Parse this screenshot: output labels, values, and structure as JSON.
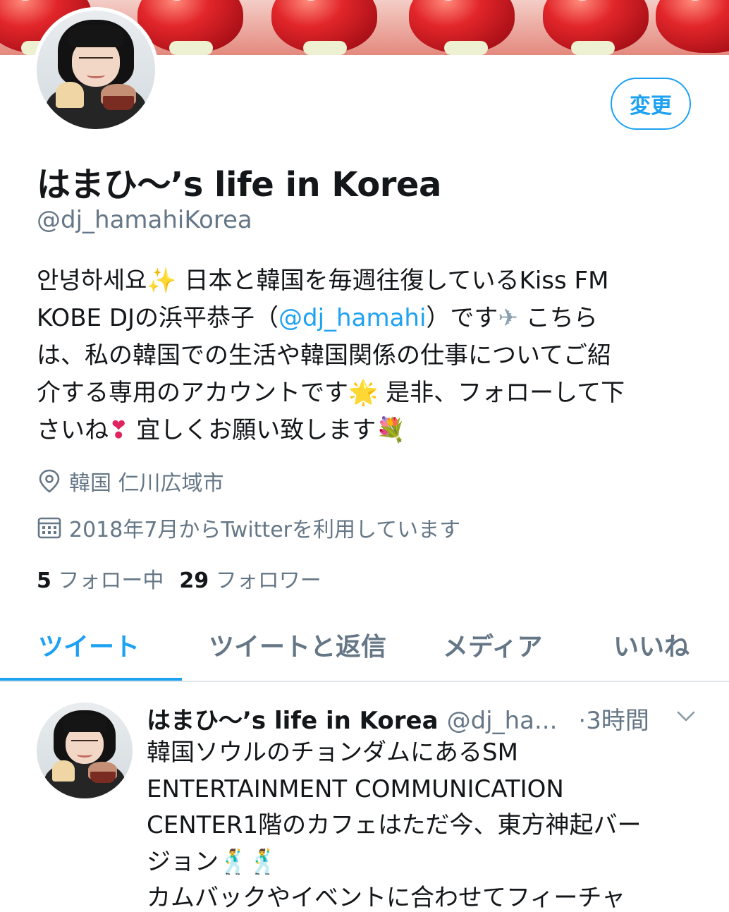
{
  "colors": {
    "accent": "#1da1f2",
    "text_primary": "#14171a",
    "text_secondary": "#657786",
    "divider": "#e1e8ed"
  },
  "header": {
    "banner_icon": "strawberry-banner-image",
    "avatar_icon": "profile-avatar-photo"
  },
  "profile": {
    "edit_button_label": "変更",
    "display_name": "はまひ〜’s life in Korea",
    "handle": "@dj_hamahiKorea",
    "bio": {
      "line1_text": "안녕하세요",
      "line1_emoji": "✨",
      "line1_rest": " 日本と韓国を毎週往復しているKiss FM",
      "line2_pre": "KOBE DJの浜平恭子（",
      "line2_link": "@dj_hamahi",
      "line2_post": "）です",
      "line2_emoji": "✈",
      "line2_tail": " こちら",
      "line3": "は、私の韓国での生活や韓国関係の仕事についてご紹",
      "line4_pre": "介する専用のアカウントです",
      "line4_emoji": "🌟",
      "line4_post": " 是非、フォローして下",
      "line5_pre": "さいね",
      "line5_emoji": "❣",
      "line5_post": " 宜しくお願い致します",
      "line5_emoji2": "💐"
    },
    "location": "韓国 仁川広域市",
    "location_icon": "location-pin-icon",
    "joined": "2018年7月からTwitterを利用しています",
    "joined_icon": "calendar-icon",
    "following_count": "5",
    "following_label": "フォロー中",
    "followers_count": "29",
    "followers_label": "フォロワー"
  },
  "tabs": [
    {
      "label": "ツイート",
      "active": true
    },
    {
      "label": "ツイートと返信",
      "active": false
    },
    {
      "label": "メディア",
      "active": false
    },
    {
      "label": "いいね",
      "active": false
    }
  ],
  "tweet": {
    "author_name": "はまひ〜’s life in Korea",
    "author_handle": "@dj_ha...",
    "time": "·3時間",
    "menu_icon": "chevron-down-icon",
    "lines": [
      "韓国ソウルのチョンダムにあるSM",
      "ENTERTAINMENT COMMUNICATION",
      "CENTER1階のカフェはただ今、東方神起バー",
      "ジョン",
      "カムバックやイベントに合わせてフィーチャ"
    ],
    "line4_emoji": "🕺🕺"
  }
}
